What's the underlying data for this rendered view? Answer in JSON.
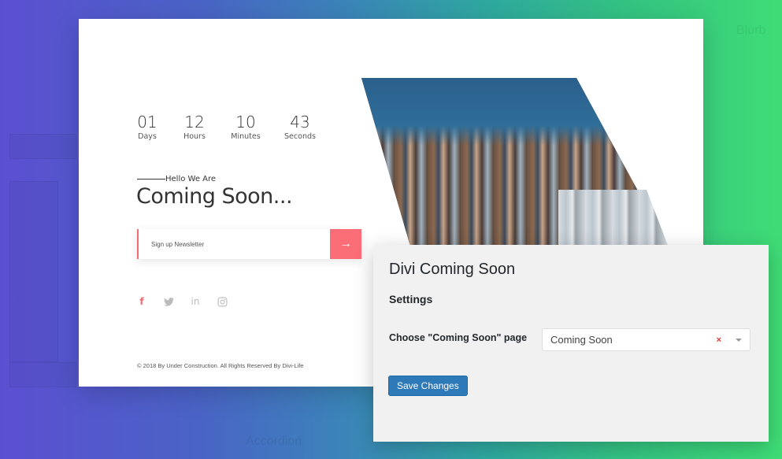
{
  "background": {
    "ghost_labels": [
      "Blurb",
      "Accordion"
    ]
  },
  "countdown": [
    {
      "value": "01",
      "label": "Days"
    },
    {
      "value": "12",
      "label": "Hours"
    },
    {
      "value": "10",
      "label": "Minutes"
    },
    {
      "value": "43",
      "label": "Seconds"
    }
  ],
  "hero": {
    "eyebrow": "Hello We Are",
    "title": "Coming Soon..."
  },
  "newsletter": {
    "placeholder": "Sign up Newsletter",
    "submit_icon": "→"
  },
  "social": [
    {
      "name": "facebook",
      "glyph": "f"
    },
    {
      "name": "twitter",
      "glyph": "🐦"
    },
    {
      "name": "linkedin",
      "glyph": "in"
    },
    {
      "name": "instagram",
      "glyph": "◎"
    }
  ],
  "footer": {
    "copyright": "© 2018 By Under Construction. All Rights Reserved By Divi-Life"
  },
  "settings": {
    "title": "Divi Coming Soon",
    "section": "Settings",
    "field_label": "Choose \"Coming Soon\" page",
    "selected_value": "Coming Soon",
    "clear_glyph": "×",
    "save_label": "Save Changes"
  },
  "colors": {
    "accent": "#fb6d77",
    "button_primary": "#2e7ab8"
  }
}
